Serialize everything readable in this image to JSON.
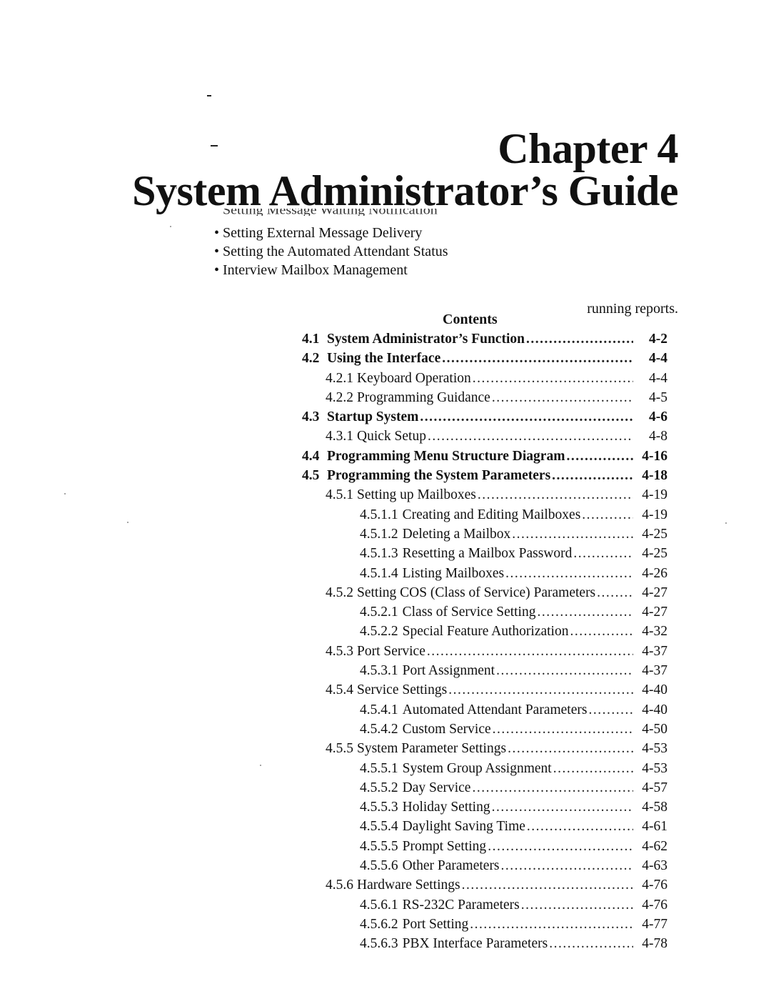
{
  "chapter": {
    "number_label": "Chapter 4",
    "title": "System Administrator’s Guide"
  },
  "partial_line": "Setting Message Waiting Notification",
  "bullets": [
    "Setting External Message Delivery",
    "Setting the Automated Attendant Status",
    "Interview Mailbox Management"
  ],
  "bullet_glyph": "•",
  "running_text": "running reports.",
  "contents": {
    "heading": "Contents",
    "entries": [
      {
        "level": 1,
        "number": "4.1",
        "title": "System Administrator’s Function",
        "page": "4-2"
      },
      {
        "level": 1,
        "number": "4.2",
        "title": "Using the Interface",
        "page": "4-4"
      },
      {
        "level": 2,
        "number": "4.2.1",
        "title": "Keyboard Operation",
        "page": "4-4"
      },
      {
        "level": 2,
        "number": "4.2.2",
        "title": "Programming Guidance",
        "page": "4-5"
      },
      {
        "level": 1,
        "number": "4.3",
        "title": "Startup System",
        "page": "4-6"
      },
      {
        "level": 2,
        "number": "4.3.1",
        "title": "Quick Setup",
        "page": "4-8"
      },
      {
        "level": 1,
        "number": "4.4",
        "title": "Programming Menu Structure Diagram",
        "page": "4-16"
      },
      {
        "level": 1,
        "number": "4.5",
        "title": "Programming the System Parameters",
        "page": "4-18"
      },
      {
        "level": 2,
        "number": "4.5.1",
        "title": "Setting up Mailboxes",
        "page": "4-19"
      },
      {
        "level": 3,
        "number": "4.5.1.1",
        "title": "Creating and Editing Mailboxes",
        "page": "4-19"
      },
      {
        "level": 3,
        "number": "4.5.1.2",
        "title": "Deleting a Mailbox",
        "page": "4-25"
      },
      {
        "level": 3,
        "number": "4.5.1.3",
        "title": "Resetting a Mailbox Password",
        "page": "4-25"
      },
      {
        "level": 3,
        "number": "4.5.1.4",
        "title": "Listing Mailboxes",
        "page": "4-26"
      },
      {
        "level": 2,
        "number": "4.5.2",
        "title": "Setting COS (Class of Service) Parameters",
        "page": "4-27"
      },
      {
        "level": 3,
        "number": "4.5.2.1",
        "title": "Class of Service Setting",
        "page": "4-27"
      },
      {
        "level": 3,
        "number": "4.5.2.2",
        "title": "Special Feature Authorization",
        "page": "4-32"
      },
      {
        "level": 2,
        "number": "4.5.3",
        "title": "Port Service",
        "page": "4-37"
      },
      {
        "level": 3,
        "number": "4.5.3.1",
        "title": "Port Assignment",
        "page": "4-37"
      },
      {
        "level": 2,
        "number": "4.5.4",
        "title": "Service Settings",
        "page": "4-40"
      },
      {
        "level": 3,
        "number": "4.5.4.1",
        "title": "Automated Attendant Parameters",
        "page": "4-40"
      },
      {
        "level": 3,
        "number": "4.5.4.2",
        "title": "Custom Service",
        "page": "4-50"
      },
      {
        "level": 2,
        "number": "4.5.5",
        "title": "System Parameter Settings",
        "page": "4-53"
      },
      {
        "level": 3,
        "number": "4.5.5.1",
        "title": "System Group Assignment",
        "page": "4-53"
      },
      {
        "level": 3,
        "number": "4.5.5.2",
        "title": "Day Service",
        "page": "4-57"
      },
      {
        "level": 3,
        "number": "4.5.5.3",
        "title": "Holiday Setting",
        "page": "4-58"
      },
      {
        "level": 3,
        "number": "4.5.5.4",
        "title": "Daylight Saving Time",
        "page": "4-61"
      },
      {
        "level": 3,
        "number": "4.5.5.5",
        "title": "Prompt Setting",
        "page": "4-62"
      },
      {
        "level": 3,
        "number": "4.5.5.6",
        "title": "Other Parameters",
        "page": "4-63"
      },
      {
        "level": 2,
        "number": "4.5.6",
        "title": "Hardware Settings",
        "page": "4-76"
      },
      {
        "level": 3,
        "number": "4.5.6.1",
        "title": "RS-232C Parameters",
        "page": "4-76"
      },
      {
        "level": 3,
        "number": "4.5.6.2",
        "title": "Port Setting",
        "page": "4-77"
      },
      {
        "level": 3,
        "number": "4.5.6.3",
        "title": "PBX Interface Parameters",
        "page": "4-78"
      }
    ]
  }
}
